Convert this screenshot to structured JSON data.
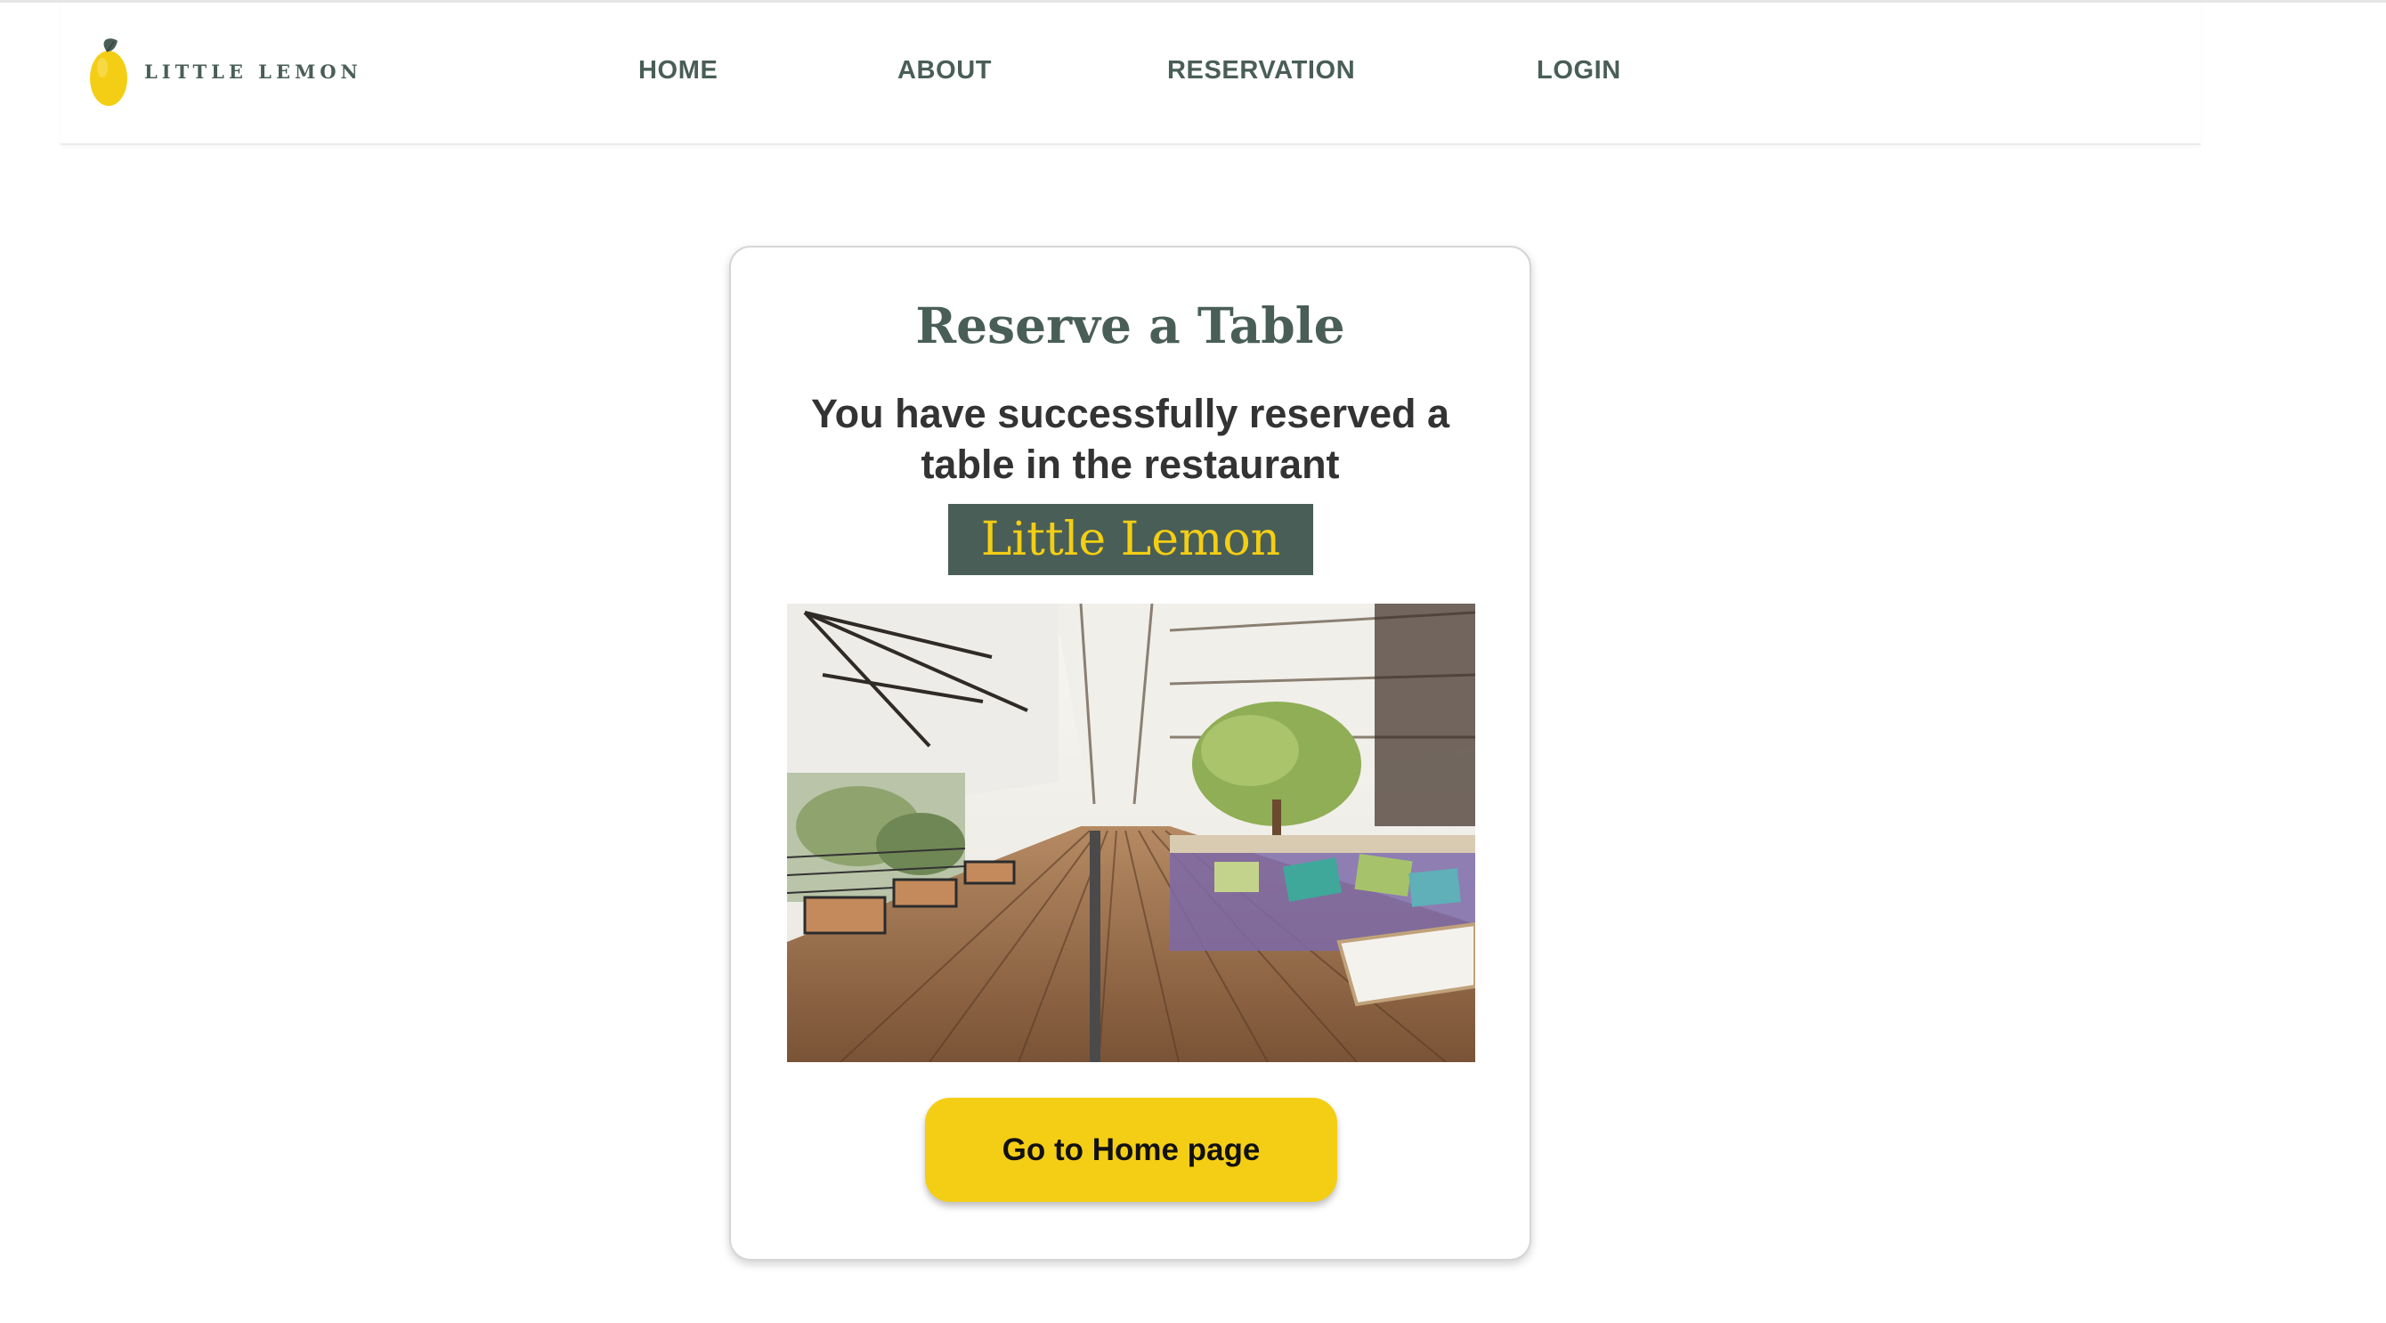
{
  "header": {
    "brand_name": "LITTLE LEMON",
    "logo_icon": "lemon-logo-icon",
    "nav": [
      {
        "label": "HOME"
      },
      {
        "label": "ABOUT"
      },
      {
        "label": "RESERVATION"
      },
      {
        "label": "LOGIN"
      }
    ]
  },
  "confirmation": {
    "title": "Reserve a Table",
    "message": "You have successfully reserved a table in the restaurant",
    "restaurant_name": "Little Lemon",
    "image_subject": "restaurant terrace",
    "button_label": "Go to Home page"
  },
  "colors": {
    "primary_green": "#495E57",
    "primary_yellow": "#F4CE14",
    "text_dark": "#333333"
  }
}
